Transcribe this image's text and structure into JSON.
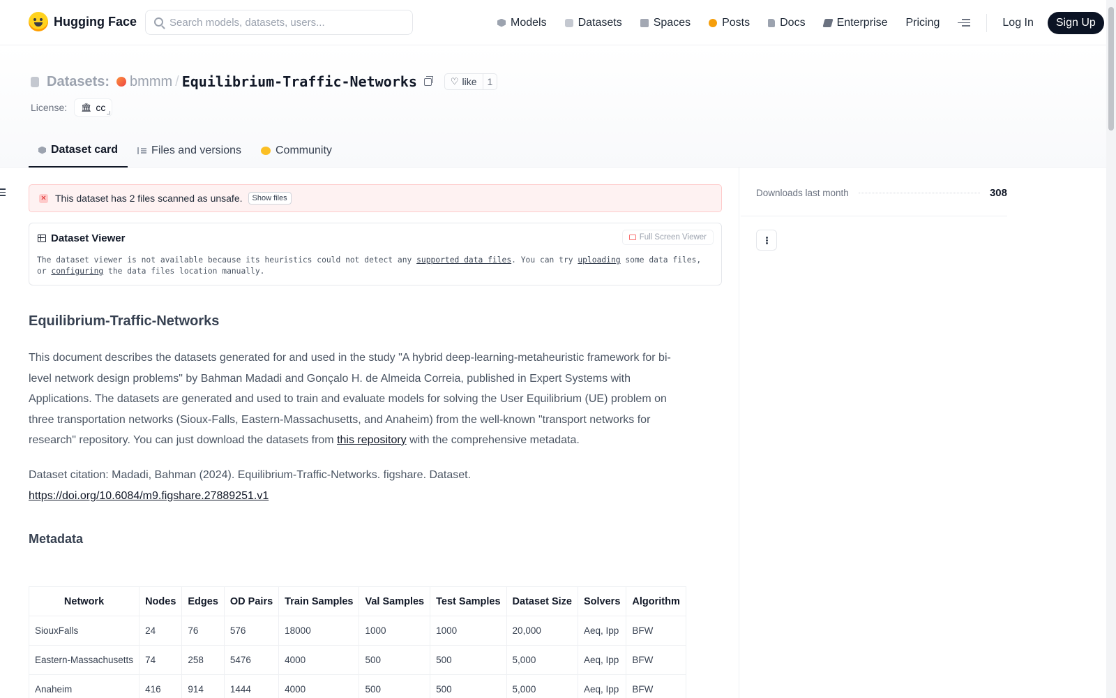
{
  "nav": {
    "logo_text": "Hugging Face",
    "search_placeholder": "Search models, datasets, users...",
    "links": [
      {
        "label": "Models",
        "icon": "models-icon"
      },
      {
        "label": "Datasets",
        "icon": "datasets-icon"
      },
      {
        "label": "Spaces",
        "icon": "spaces-icon"
      },
      {
        "label": "Posts",
        "icon": "posts-icon"
      },
      {
        "label": "Docs",
        "icon": "docs-icon"
      },
      {
        "label": "Enterprise",
        "icon": "enterprise-icon"
      },
      {
        "label": "Pricing"
      }
    ],
    "login": "Log In",
    "signup": "Sign Up"
  },
  "header": {
    "type_label": "Datasets:",
    "owner": "bmmm",
    "separator": "/",
    "name": "Equilibrium-Traffic-Networks",
    "like_label": "like",
    "like_count": "1",
    "license_label": "License:",
    "license_value": "cc"
  },
  "tabs": [
    {
      "label": "Dataset card",
      "active": true
    },
    {
      "label": "Files and versions"
    },
    {
      "label": "Community"
    }
  ],
  "alert": {
    "text": "This dataset has 2 files scanned as unsafe.",
    "button": "Show files"
  },
  "viewer": {
    "title": "Dataset Viewer",
    "fullscreen": "Full Screen Viewer",
    "msg_part1": "The dataset viewer is not available because its heuristics could not detect any ",
    "link1": "supported data files",
    "msg_part2": ". You can try ",
    "link2": "uploading",
    "msg_part3": " some data files, or ",
    "link3": "configuring",
    "msg_part4": " the data files location manually."
  },
  "card": {
    "heading": "Equilibrium-Traffic-Networks",
    "paragraph_before_link": "This document describes the datasets generated for and used in the study \"A hybrid deep-learning-metaheuristic framework for bi-level network design problems\" by Bahman Madadi and Gonçalo H. de Almeida Correia, published in Expert Systems with Applications. The datasets are generated and used to train and evaluate models for solving the User Equilibrium (UE) problem on three transportation networks (Sioux-Falls, Eastern-Massachusetts, and Anaheim) from the well-known \"transport networks for research\" repository. You can just download the datasets from ",
    "paragraph_link": "this repository",
    "paragraph_after_link": " with the comprehensive metadata.",
    "citation_text": "Dataset citation: Madadi, Bahman (2024). Equilibrium-Traffic-Networks. figshare. Dataset.",
    "citation_link": "https://doi.org/10.6084/m9.figshare.27889251.v1",
    "metadata_heading": "Metadata"
  },
  "metadata_table": {
    "headers": [
      "Network",
      "Nodes",
      "Edges",
      "OD Pairs",
      "Train Samples",
      "Val Samples",
      "Test Samples",
      "Dataset Size",
      "Solvers",
      "Algorithm"
    ],
    "rows": [
      [
        "SiouxFalls",
        "24",
        "76",
        "576",
        "18000",
        "1000",
        "1000",
        "20,000",
        "Aeq, Ipp",
        "BFW"
      ],
      [
        "Eastern-Massachusetts",
        "74",
        "258",
        "5476",
        "4000",
        "500",
        "500",
        "5,000",
        "Aeq, Ipp",
        "BFW"
      ],
      [
        "Anaheim",
        "416",
        "914",
        "1444",
        "4000",
        "500",
        "500",
        "5,000",
        "Aeq, Ipp",
        "BFW"
      ]
    ]
  },
  "sidebar": {
    "downloads_label": "Downloads last month",
    "downloads_value": "308"
  }
}
